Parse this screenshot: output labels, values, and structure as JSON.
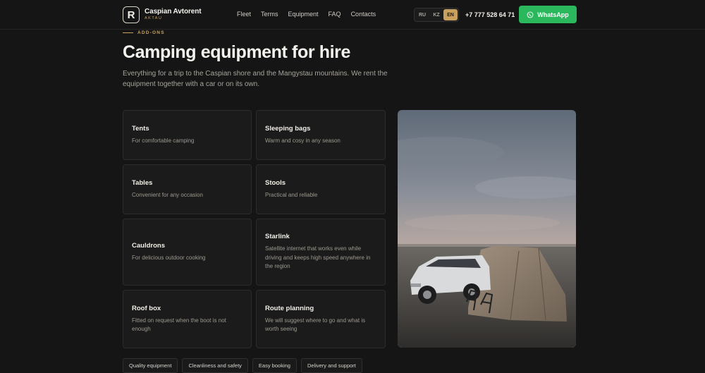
{
  "brand": {
    "name": "Caspian Avtorent",
    "city": "AKTAU",
    "logo_letter": "R"
  },
  "nav": [
    "Fleet",
    "Terms",
    "Equipment",
    "FAQ",
    "Contacts"
  ],
  "languages": [
    {
      "code": "RU",
      "active": false
    },
    {
      "code": "KZ",
      "active": false
    },
    {
      "code": "EN",
      "active": true
    }
  ],
  "phone": "+7 777 528 64 71",
  "whatsapp_label": "WhatsApp",
  "section": {
    "eyebrow": "ADD-ONS",
    "title": "Camping equipment for hire",
    "lead": "Everything for a trip to the Caspian shore and the Mangystau mountains. We rent the equipment together with a car or on its own."
  },
  "cards": [
    {
      "title": "Tents",
      "desc": "For comfortable camping"
    },
    {
      "title": "Sleeping bags",
      "desc": "Warm and cosy in any season"
    },
    {
      "title": "Tables",
      "desc": "Convenient for any occasion"
    },
    {
      "title": "Stools",
      "desc": "Practical and reliable"
    },
    {
      "title": "Cauldrons",
      "desc": "For delicious outdoor cooking"
    },
    {
      "title": "Starlink",
      "desc": "Satellite internet that works even while driving and keeps high speed anywhere in the region"
    },
    {
      "title": "Roof box",
      "desc": "Fitted on request when the boot is not enough"
    },
    {
      "title": "Route planning",
      "desc": "We will suggest where to go and what is worth seeing"
    }
  ],
  "photo": {
    "subject": "SUV and inflatable tent on the Caspian shore at dusk",
    "icon": "photo"
  },
  "tags": [
    "Quality equipment",
    "Cleanliness and safety",
    "Easy booking",
    "Delivery and support"
  ],
  "colors": {
    "accent": "#c8a15e",
    "whatsapp": "#2bb85c",
    "background": "#151515"
  }
}
